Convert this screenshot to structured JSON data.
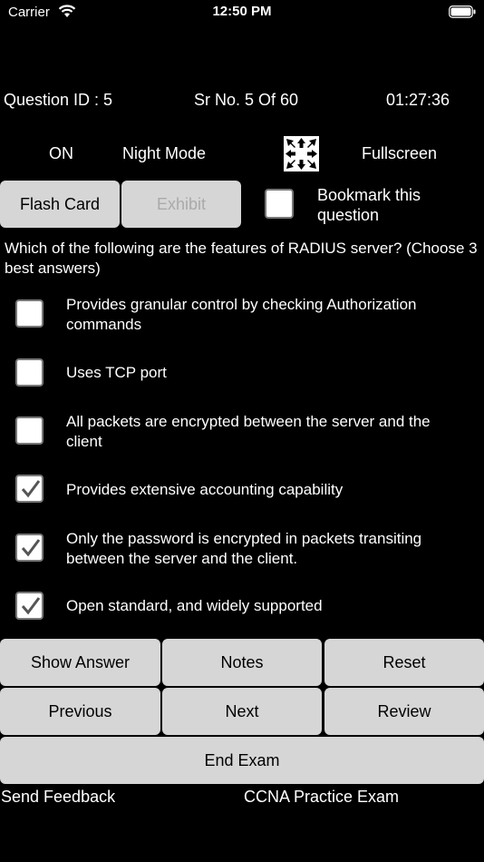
{
  "status": {
    "carrier": "Carrier",
    "time": "12:50 PM"
  },
  "header": {
    "question_id": "Question ID : 5",
    "sr_no": "Sr No. 5 Of 60",
    "timer": "01:27:36"
  },
  "night": {
    "on_label": "ON",
    "night_mode_label": "Night Mode",
    "fullscreen_label": "Fullscreen"
  },
  "actions": {
    "flash_card": "Flash Card",
    "exhibit": "Exhibit",
    "bookmark": "Bookmark this question"
  },
  "question": "Which of the following are the features of RADIUS server? (Choose 3 best answers)",
  "options": [
    {
      "text": "Provides granular control by checking Authorization commands",
      "checked": false
    },
    {
      "text": "Uses TCP port",
      "checked": false
    },
    {
      "text": "All packets are encrypted between the server and the client",
      "checked": false
    },
    {
      "text": "Provides extensive accounting capability",
      "checked": true
    },
    {
      "text": "Only the password is encrypted in packets transiting between the server and the client.",
      "checked": true
    },
    {
      "text": "Open standard, and widely supported",
      "checked": true
    }
  ],
  "buttons": {
    "show_answer": "Show Answer",
    "notes": "Notes",
    "reset": "Reset",
    "previous": "Previous",
    "next": "Next",
    "review": "Review",
    "end_exam": "End Exam"
  },
  "footer": {
    "feedback": "Send Feedback",
    "app_name": "CCNA Practice Exam"
  },
  "icons": {
    "wifi": "wifi-icon",
    "battery": "battery-icon",
    "fullscreen": "fullscreen-arrows-icon",
    "check": "checkmark-icon"
  }
}
